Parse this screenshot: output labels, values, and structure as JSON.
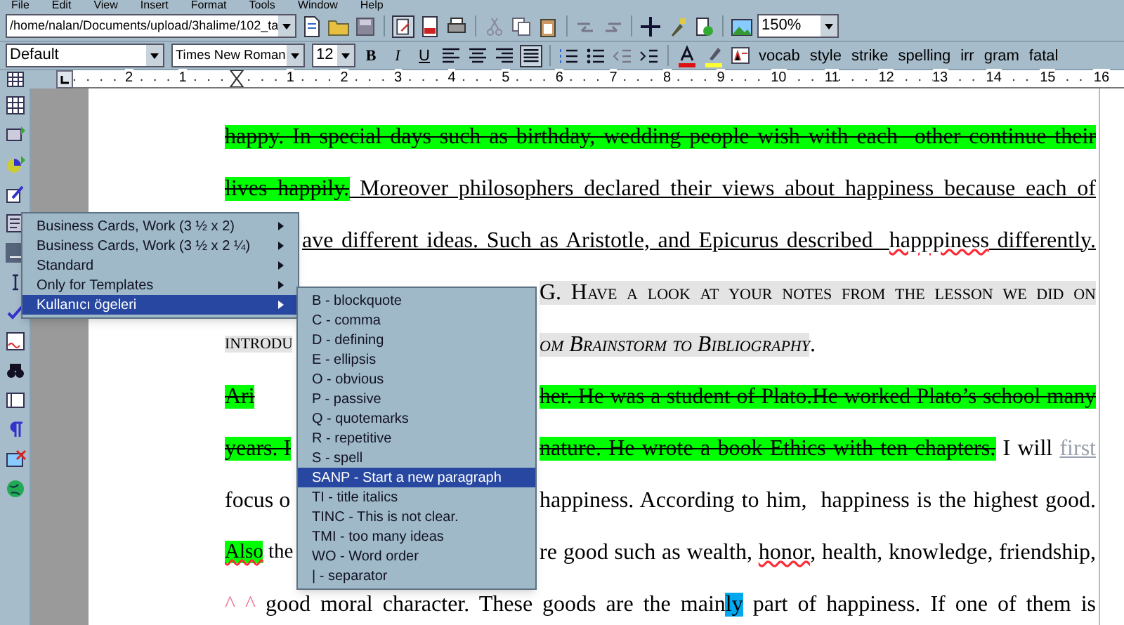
{
  "menu_bar": [
    "File",
    "Edit",
    "View",
    "Insert",
    "Format",
    "Tools",
    "Window",
    "Help"
  ],
  "toolbar": {
    "path": "/home/nalan/Documents/upload/3halime/102_ta",
    "zoom": "150%"
  },
  "format_bar": {
    "style": "Default",
    "font": "Times New Roman",
    "size": "12",
    "bold": "B",
    "italic": "I",
    "underline": "U",
    "alignment": [
      {
        "selected": false
      },
      {
        "selected": false
      },
      {
        "selected": false
      },
      {
        "selected": true
      }
    ],
    "buttons": [
      "vocab",
      "style",
      "strike",
      "spelling",
      "irr",
      "gram",
      "fatal"
    ]
  },
  "ruler": {
    "labels": [
      "2",
      "1",
      "1",
      "2",
      "3",
      "4",
      "5",
      "6",
      "7",
      "8",
      "9",
      "10",
      "11",
      "12",
      "13",
      "14",
      "15",
      "16"
    ]
  },
  "document": {
    "lines": [
      {
        "left": [
          {
            "text": "happy. In special days such as birthday, wedding people wish with each  other continue their",
            "kind": "strike-green"
          }
        ]
      },
      {
        "left": [
          {
            "text": "lives happily.",
            "kind": "strike-green"
          },
          {
            "text": " Moreover philosophers declared their views about happiness because each of",
            "kind": "underline"
          }
        ]
      },
      {
        "right": [
          {
            "text": "ave different ideas. Such as Aristotle, and Epicurus described  ",
            "kind": "underline"
          },
          {
            "text": "happpiness",
            "kind": "misspelled"
          },
          {
            "text": " differently.",
            "kind": "underline"
          }
        ]
      },
      {
        "right": [
          {
            "text": "G. Have a look at your notes from the lesson we did on",
            "kind": "smallcaps"
          }
        ]
      },
      {
        "left": [
          {
            "text": "INTRODU",
            "kind": "smallcaps"
          }
        ],
        "right": [
          {
            "text": "om Brainstorm to Bibliography",
            "kind": "smallcaps-italic"
          },
          {
            "text": ".",
            "kind": "plain"
          }
        ]
      },
      {
        "left": [
          {
            "text": "Ari",
            "kind": "strike-green"
          }
        ],
        "right": [
          {
            "text": "her. He was a student of Plato.He worked Plato’s school many",
            "kind": "strike-green"
          }
        ]
      },
      {
        "left": [
          {
            "text": "years. I",
            "kind": "strike-green"
          }
        ],
        "right": [
          {
            "text": "nature. He wrote a book Ethics with ten chapters.",
            "kind": "strike-green"
          },
          {
            "text": " I will ",
            "kind": "plain"
          },
          {
            "text": "first",
            "kind": "faint-underline"
          }
        ]
      },
      {
        "left": [
          {
            "text": "focus o",
            "kind": "plain"
          }
        ],
        "right": [
          {
            "text": "happiness. According to him,  happiness is the highest good.",
            "kind": "plain"
          }
        ]
      },
      {
        "left": [
          {
            "text": "Also",
            "kind": "green-misspelled"
          },
          {
            "text": " the",
            "kind": "plain"
          }
        ],
        "right": [
          {
            "text": "re good such as wealth, ",
            "kind": "plain"
          },
          {
            "text": "honor",
            "kind": "misspelled"
          },
          {
            "text": ", health, knowledge, friendship,",
            "kind": "plain"
          }
        ]
      },
      {
        "left": [
          {
            "text": "^ ^ ",
            "kind": "marks"
          },
          {
            "text": "good moral character. These goods are the main",
            "kind": "plain"
          },
          {
            "text": "ly",
            "kind": "blue-highlight"
          },
          {
            "text": " part of happiness. If one of them is",
            "kind": "plain"
          }
        ]
      }
    ]
  },
  "context_menu": {
    "items": [
      {
        "label": "Business Cards, Work (3 ½ x 2)",
        "selected": false
      },
      {
        "label": "Business Cards, Work (3 ½ x 2 ¼)",
        "selected": false
      },
      {
        "label": "Standard",
        "selected": false
      },
      {
        "label": "Only for Templates",
        "selected": false
      },
      {
        "label": "Kullanıcı ögeleri",
        "selected": true
      }
    ]
  },
  "submenu": {
    "items": [
      {
        "label": "B - blockquote",
        "selected": false
      },
      {
        "label": "C - comma",
        "selected": false
      },
      {
        "label": "D - defining",
        "selected": false
      },
      {
        "label": "E - ellipsis",
        "selected": false
      },
      {
        "label": "O - obvious",
        "selected": false
      },
      {
        "label": "P - passive",
        "selected": false
      },
      {
        "label": "Q - quotemarks",
        "selected": false
      },
      {
        "label": "R - repetitive",
        "selected": false
      },
      {
        "label": "S - spell",
        "selected": false
      },
      {
        "label": "SANP -  Start a new paragraph",
        "selected": true
      },
      {
        "label": "TI - title italics",
        "selected": false
      },
      {
        "label": "TINC - This is not clear.",
        "selected": false
      },
      {
        "label": "TMI - too many ideas",
        "selected": false
      },
      {
        "label": "WO - Word order",
        "selected": false
      },
      {
        "label": "| - separator",
        "selected": false
      }
    ]
  }
}
